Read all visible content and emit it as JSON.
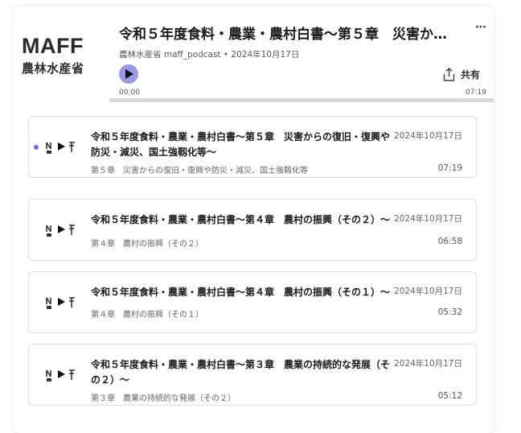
{
  "brand": {
    "logo_text": "MAFF",
    "logo_subtext": "農林水産省"
  },
  "player": {
    "title": "令和５年度食料・農業・農村白書～第５章　災害からの復旧・復興や防災・減災、国土強靱化等～",
    "meta": "農林水産省 maff_podcast • 2024年10月17日",
    "share_label": "共有",
    "current_time": "00:00",
    "total_time": "07:19",
    "progress_fraction": 0,
    "accent_color": "#9b98ea"
  },
  "episodes": [
    {
      "title": "令和５年度食料・農業・農村白書～第５章　災害からの復旧・復興や防災・減災、国土強靱化等～",
      "date": "2024年10月17日",
      "subtitle": "第５章　災害からの復旧・復興や防災・減災、国土強靱化等",
      "duration": "07:19",
      "current": true
    },
    {
      "title": "令和５年度食料・農業・農村白書～第４章　農村の振興（その２）～",
      "date": "2024年10月17日",
      "subtitle": "第４章　農村の振興（その２）",
      "duration": "06:58",
      "current": false
    },
    {
      "title": "令和５年度食料・農業・農村白書～第４章　農村の振興（その１）～",
      "date": "2024年10月17日",
      "subtitle": "第４章　農村の振興（その１）",
      "duration": "05:32",
      "current": false
    },
    {
      "title": "令和５年度食料・農業・農村白書～第３章　農業の持続的な発展（その２）～",
      "date": "2024年10月17日",
      "subtitle": "第３章　農業の持続的な発展（その２）",
      "duration": "05:12",
      "current": false
    }
  ]
}
